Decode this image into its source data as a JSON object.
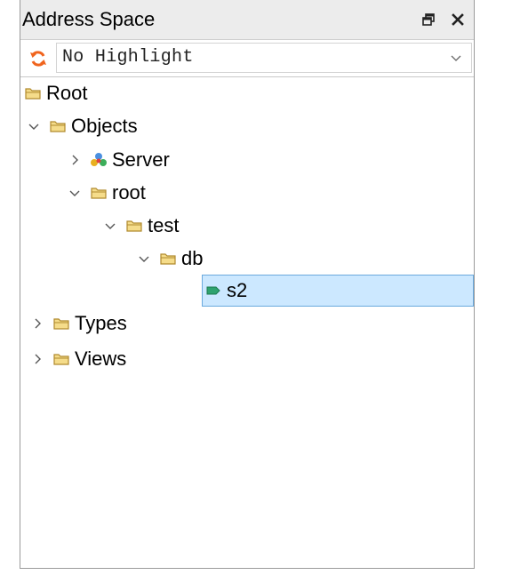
{
  "panel": {
    "title": "Address Space",
    "restore_icon": "restore-window-icon",
    "close_icon": "close-icon"
  },
  "highlight": {
    "refresh_icon": "refresh-icon",
    "selected": "No Highlight"
  },
  "tree": {
    "root": {
      "label": "Root",
      "icon": "folder-icon"
    },
    "objects": {
      "label": "Objects",
      "icon": "folder-icon",
      "expanded": true
    },
    "server": {
      "label": "Server",
      "icon": "server-object-icon",
      "expanded": false
    },
    "root_folder": {
      "label": "root",
      "icon": "folder-icon",
      "expanded": true
    },
    "test": {
      "label": "test",
      "icon": "folder-icon",
      "expanded": true
    },
    "db": {
      "label": "db",
      "icon": "folder-icon",
      "expanded": true
    },
    "s2": {
      "label": "s2",
      "icon": "variable-tag-icon",
      "selected": true
    },
    "types": {
      "label": "Types",
      "icon": "folder-icon",
      "expanded": false
    },
    "views": {
      "label": "Views",
      "icon": "folder-icon",
      "expanded": false
    }
  },
  "colors": {
    "selection_bg": "#cce8ff",
    "selection_border": "#6aa9dd",
    "folder": "#e8c65a",
    "refresh": "#f0641e",
    "tag": "#2fa36f"
  }
}
